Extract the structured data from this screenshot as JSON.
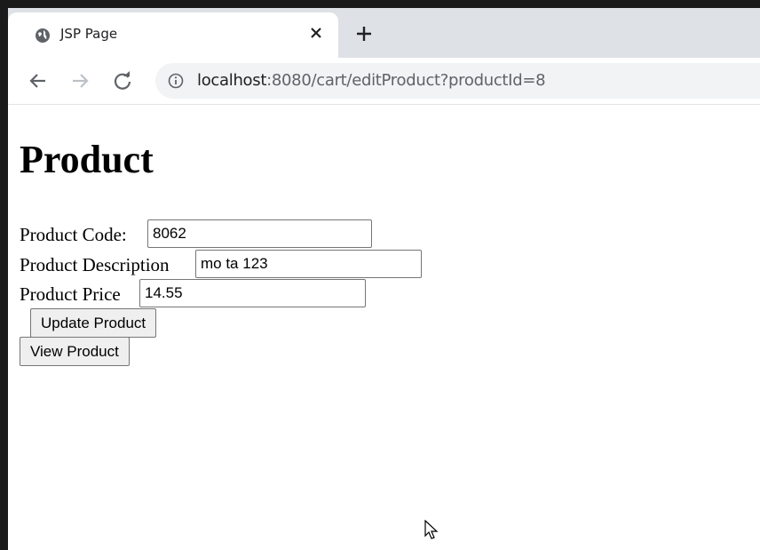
{
  "browser": {
    "tab_title": "JSP Page",
    "url_host": "localhost",
    "url_rest": ":8080/cart/editProduct?productId=8",
    "icons": {
      "favicon": "globe-icon",
      "close": "close-icon",
      "new_tab": "plus-icon",
      "back": "back-arrow-icon",
      "forward": "forward-arrow-icon",
      "reload": "reload-icon",
      "site_info": "info-icon"
    }
  },
  "page": {
    "title": "Product",
    "fields": {
      "code": {
        "label": "Product Code:",
        "value": "8062"
      },
      "description": {
        "label": "Product Description",
        "value": "mo ta 123"
      },
      "price": {
        "label": "Product Price",
        "value": "14.55"
      }
    },
    "update_button": "Update Product",
    "view_button": "View Product"
  }
}
